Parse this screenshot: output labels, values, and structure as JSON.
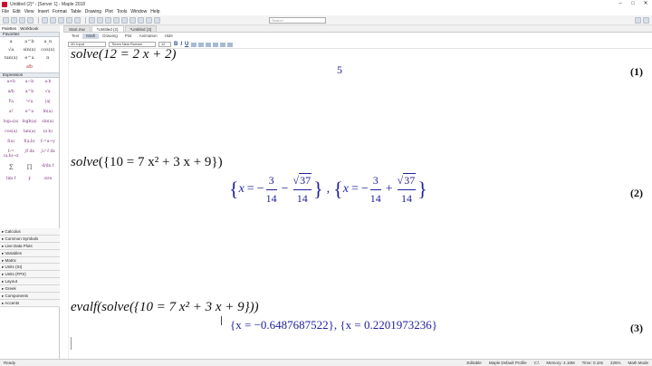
{
  "window": {
    "title": "Untitled (2)* - [Server 1] - Maple 2018",
    "controls": [
      "–",
      "□",
      "✕"
    ]
  },
  "menu": [
    "File",
    "Edit",
    "View",
    "Insert",
    "Format",
    "Table",
    "Drawing",
    "Plot",
    "Tools",
    "Window",
    "Help"
  ],
  "search": {
    "placeholder": "Search"
  },
  "palette_tabs": [
    "Palettes",
    "Workbook"
  ],
  "sidebar": {
    "favorites": "Favorites",
    "favorites_items": [
      "a",
      "a^b",
      "a_n",
      "√a",
      "sin(x)",
      "cos(x)",
      "tan(x)",
      "e^a",
      "π"
    ],
    "favorites_frac": "a/b",
    "expression": "Expression",
    "expression_items": [
      "a+b",
      "a−b",
      "a·b",
      "a/b",
      "a^b",
      "√a",
      "∜a",
      "ⁿ√a",
      "|a|",
      "a!",
      "e^a",
      "ln(a)",
      "log₁₀(a)",
      "logb(a)",
      "sin(a)",
      "cos(a)",
      "tan(a)",
      "(a b)",
      "f(a)",
      "f(a,b)",
      "f:=a→y",
      "f:=(a,b)→z",
      "∫f dx",
      "∫ₐᵇ f dx",
      "Σ",
      "Π",
      "d/dx f",
      "lim f",
      "∮",
      "∂/∂x"
    ],
    "collapsed": [
      "Calculus",
      "Common Symbols",
      "Live Data Plots",
      "Variables",
      "Matrix",
      "Units (SI)",
      "Units (FPS)",
      "Layout",
      "Greek",
      "Components",
      "Accents"
    ]
  },
  "doc_tabs": [
    "Start.mw",
    "*Untitled (2)",
    "*Untitled (3)"
  ],
  "mode_tabs": [
    "Text",
    "Math",
    "Drawing",
    "Plot",
    "Animation",
    "Hide"
  ],
  "format": {
    "style": "2D Input",
    "font": "Times New Roman",
    "size": "12",
    "bold": "B",
    "italic": "I",
    "underline": "U"
  },
  "worksheet": {
    "line1": {
      "input": "solve(12 = 2 x + 2)",
      "output": "5",
      "label": "(1)"
    },
    "line2": {
      "input_fn": "solve",
      "input_body": "{10 = 7 x² + 3 x + 9}",
      "sol1": {
        "x": "x",
        "eq": "=",
        "minus": "−",
        "num": "3",
        "den": "14",
        "op": "−",
        "rad": "37",
        "rad_den": "14"
      },
      "sol2": {
        "x": "x",
        "eq": "=",
        "minus": "−",
        "num": "3",
        "den": "14",
        "op": "+",
        "rad": "37",
        "rad_den": "14"
      },
      "comma": ",",
      "label": "(2)"
    },
    "line3": {
      "input": "evalf(solve({10 = 7 x² + 3 x + 9}))",
      "output": "{x = −0.6487687522}, {x = 0.2201973236}",
      "label": "(3)"
    }
  },
  "status": {
    "ready": "Ready",
    "editable": "Editable",
    "profile": "Maple Default Profile",
    "dir": "C:\\",
    "memory": "Memory: 4.18M",
    "time": "Time: 0.10s",
    "zoom": "225%",
    "mode": "Math Mode"
  }
}
